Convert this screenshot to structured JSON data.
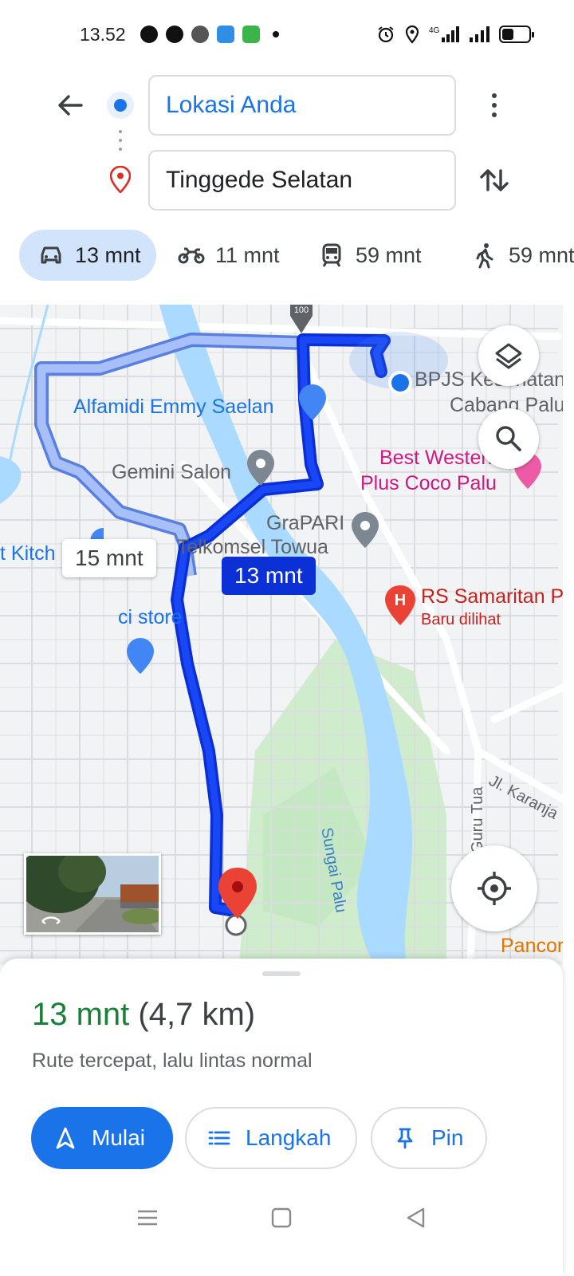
{
  "status_bar": {
    "time": "13.52",
    "left_icons": [
      "whatsapp-icon",
      "line-icon",
      "app-icon",
      "files-icon",
      "android-icon",
      "dot-icon"
    ],
    "right_icons": [
      "alarm-icon",
      "location-icon",
      "4g-signal-icon",
      "signal-icon",
      "battery-icon"
    ],
    "network": "4G",
    "battery_level": 0.4
  },
  "directions": {
    "origin": "Lokasi Anda",
    "destination": "Tinggede Selatan"
  },
  "modes": [
    {
      "mode": "car",
      "label": "13 mnt",
      "active": true
    },
    {
      "mode": "motorcycle",
      "label": "11 mnt",
      "active": false
    },
    {
      "mode": "transit",
      "label": "59 mnt",
      "active": false
    },
    {
      "mode": "walk",
      "label": "59 mnt",
      "active": false
    }
  ],
  "map": {
    "road_shield": "100",
    "labels": {
      "alfamidi": "Alfamidi Emmy Saelan",
      "bpjs_1": "BPJS Kesehatan",
      "bpjs_2": "Cabang Palu",
      "gemini": "Gemini Salon",
      "best_western_1": "Best Western",
      "best_western_2": "Plus Coco Palu",
      "grapari": "GraPARI",
      "telkomsel": "Telkomsel Towua",
      "kitchen": "t Kitch",
      "rs_samaritan": "RS Samaritan P",
      "recently_viewed": "Baru dilihat",
      "ci_store": "ci store",
      "sungai_palu": "Sungai Palu",
      "guru_tua": "Guru Tua",
      "jl_karanja": "Jl. Karanja",
      "pancor": "Pancor"
    },
    "alt_route_time": "15 mnt",
    "main_route_time": "13 mnt",
    "route_color": "#1a3ce8",
    "alt_route_color": "#8ab4f8"
  },
  "summary": {
    "duration": "13 mnt",
    "distance": "(4,7 km)",
    "note": "Rute tercepat, lalu lintas normal"
  },
  "actions": {
    "start": "Mulai",
    "steps": "Langkah",
    "pin": "Pin"
  },
  "colors": {
    "accent": "#1a73e8",
    "duration_green": "#188038",
    "chip_active_bg": "#d2e3fc",
    "destination_red": "#ea4335"
  }
}
